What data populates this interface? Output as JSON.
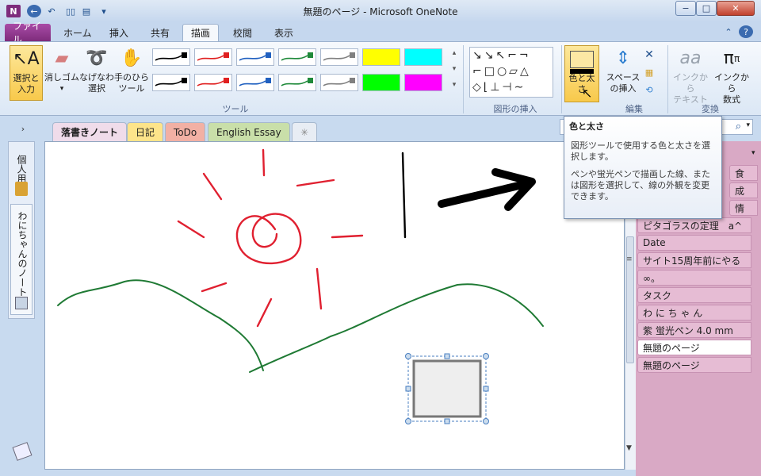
{
  "app": {
    "title": "無題のページ - Microsoft OneNote",
    "logo_letter": "N"
  },
  "quick_access": {
    "back": "←",
    "undo": "↶"
  },
  "window_controls": {
    "minimize": "−",
    "maximize": "□",
    "close": "✕"
  },
  "ribbon_tabs": [
    "ファイル",
    "ホーム",
    "挿入",
    "共有",
    "描画",
    "校閲",
    "表示"
  ],
  "ribbon": {
    "tools": {
      "select_label": "選択と\n入力",
      "eraser_label": "消しゴム",
      "lasso_label": "なげなわ\n選択",
      "pan_label": "手のひら\nツール",
      "group_label": "ツール"
    },
    "pen_colors": [
      "#000000",
      "#e02020",
      "#2060c0",
      "#1f8a3a",
      "#808080",
      "#ffff00",
      "#00ffff",
      "#000000",
      "#e02020",
      "#2060c0",
      "#1f8a3a",
      "#808080",
      "#00ff00",
      "#ff00ff"
    ],
    "shapes": {
      "group_label": "図形の挿入",
      "color_weight_label": "色と太さ"
    },
    "edit": {
      "space_label": "スペース\nの挿入",
      "group_label": "編集"
    },
    "convert": {
      "ink_to_text": "インクから\nテキスト",
      "ink_to_math": "インクから\n数式",
      "group_label": "変換"
    }
  },
  "notebooks": {
    "personal": "個人用",
    "wani": "わにちゃんのノート"
  },
  "section_tabs": [
    "落書きノート",
    "日記",
    "ToDo",
    "English Essay",
    "✳"
  ],
  "pages": [
    "食",
    "成",
    "情",
    "ピタゴラスの定理　a^",
    "Date",
    "サイト15周年前にやる",
    "∞。",
    "タスク",
    "わ に ち ゃ ん",
    "紫 蛍光ペン 4.0 mm",
    "無題のページ",
    "無題のページ"
  ],
  "active_page_index": 10,
  "tooltip": {
    "title": "色と太さ",
    "line1": "図形ツールで使用する色と太さを選択します。",
    "line2": "ペンや蛍光ペンで描画した線、または図形を選択して、線の外観を変更できます。"
  },
  "colors": {
    "accent": "#7e2c7c",
    "sun": "#e02030",
    "hill": "#1f7a34",
    "page_tab": "#e6bcd4"
  }
}
